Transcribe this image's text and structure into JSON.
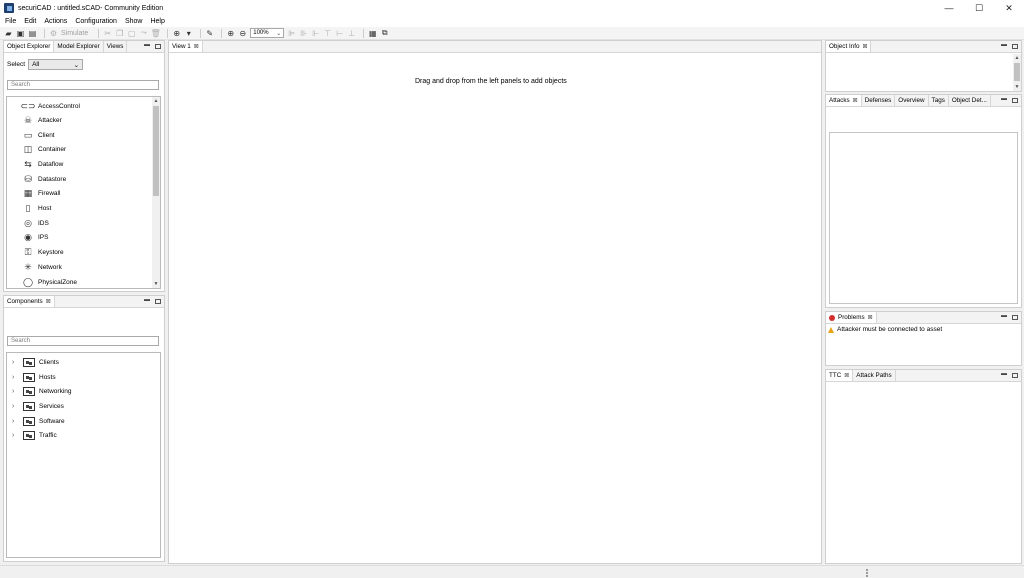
{
  "window": {
    "title": "securiCAD : untitled.sCAD- Community Edition",
    "controls": [
      "—",
      "☐",
      "✕"
    ]
  },
  "menu": [
    "File",
    "Edit",
    "Actions",
    "Configuration",
    "Show",
    "Help"
  ],
  "toolbar": {
    "simulate_label": "Simulate",
    "zoom_value": "100%"
  },
  "left_top": {
    "tabs": [
      "Object Explorer",
      "Model Explorer",
      "Views"
    ],
    "select_label": "Select",
    "select_value": "All",
    "search_placeholder": "Search",
    "items": [
      {
        "label": "AccessControl",
        "icon": "access-control-icon",
        "glyph": "⊂⊃"
      },
      {
        "label": "Attacker",
        "icon": "attacker-icon",
        "glyph": "☠"
      },
      {
        "label": "Client",
        "icon": "client-icon",
        "glyph": "▭"
      },
      {
        "label": "Container",
        "icon": "container-icon",
        "glyph": "◫"
      },
      {
        "label": "Dataflow",
        "icon": "dataflow-icon",
        "glyph": "⇆"
      },
      {
        "label": "Datastore",
        "icon": "datastore-icon",
        "glyph": "⛁"
      },
      {
        "label": "Firewall",
        "icon": "firewall-icon",
        "glyph": "▦"
      },
      {
        "label": "Host",
        "icon": "host-icon",
        "glyph": "▯"
      },
      {
        "label": "IDS",
        "icon": "ids-icon",
        "glyph": "◎"
      },
      {
        "label": "IPS",
        "icon": "ips-icon",
        "glyph": "◉"
      },
      {
        "label": "Keystore",
        "icon": "keystore-icon",
        "glyph": "⚿"
      },
      {
        "label": "Network",
        "icon": "network-icon",
        "glyph": "✳"
      },
      {
        "label": "PhysicalZone",
        "icon": "physical-zone-icon",
        "glyph": "◯"
      }
    ]
  },
  "components": {
    "tab": "Components",
    "search_placeholder": "Search",
    "items": [
      "Clients",
      "Hosts",
      "Networking",
      "Services",
      "Software",
      "Traffic"
    ]
  },
  "editor": {
    "tab": "View 1",
    "hint": "Drag and drop from the left panels to add objects"
  },
  "right": {
    "object_info_tab": "Object Info",
    "attack_tabs": [
      "Attacks",
      "Defenses",
      "Overview",
      "Tags",
      "Object Det..."
    ],
    "problems_tab": "Problems",
    "problem_message": "Attacker must be connected to asset",
    "ttc_tabs": [
      "TTC",
      "Attack Paths"
    ]
  }
}
